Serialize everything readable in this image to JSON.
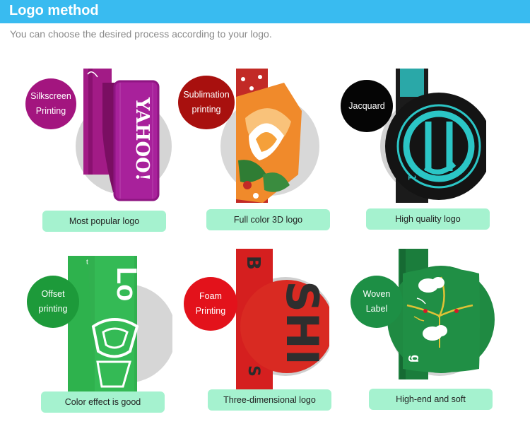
{
  "header": {
    "title": "Logo method"
  },
  "subtitle": "You can choose the desired process according to your logo.",
  "colors": {
    "header_bar": "#39bbf0",
    "caption_bg": "#a5f2cf"
  },
  "methods": [
    {
      "bubble_line1": "Silkscreen",
      "bubble_line2": "Printing",
      "caption": "Most popular logo",
      "strap_text": "YAHOO!",
      "bubble_color": "#a3157f"
    },
    {
      "bubble_line1": "Sublimation",
      "bubble_line2": "printing",
      "caption": "Full color 3D logo",
      "bubble_color": "#a8100e"
    },
    {
      "bubble_line1": "Jacquard",
      "bubble_line2": "",
      "caption": "High quality logo",
      "bubble_color": "#050505"
    },
    {
      "bubble_line1": "Offset",
      "bubble_line2": "printing",
      "caption": "Color effect is good",
      "strap_text": "Lo",
      "bubble_color": "#1d9a3a"
    },
    {
      "bubble_line1": "Foam",
      "bubble_line2": "Printing",
      "caption": "Three-dimensional logo",
      "strap_text": "SHI",
      "bubble_color": "#e3121b"
    },
    {
      "bubble_line1": "Woven",
      "bubble_line2": "Label",
      "caption": "High-end and soft",
      "bubble_color": "#1d8f45"
    }
  ]
}
